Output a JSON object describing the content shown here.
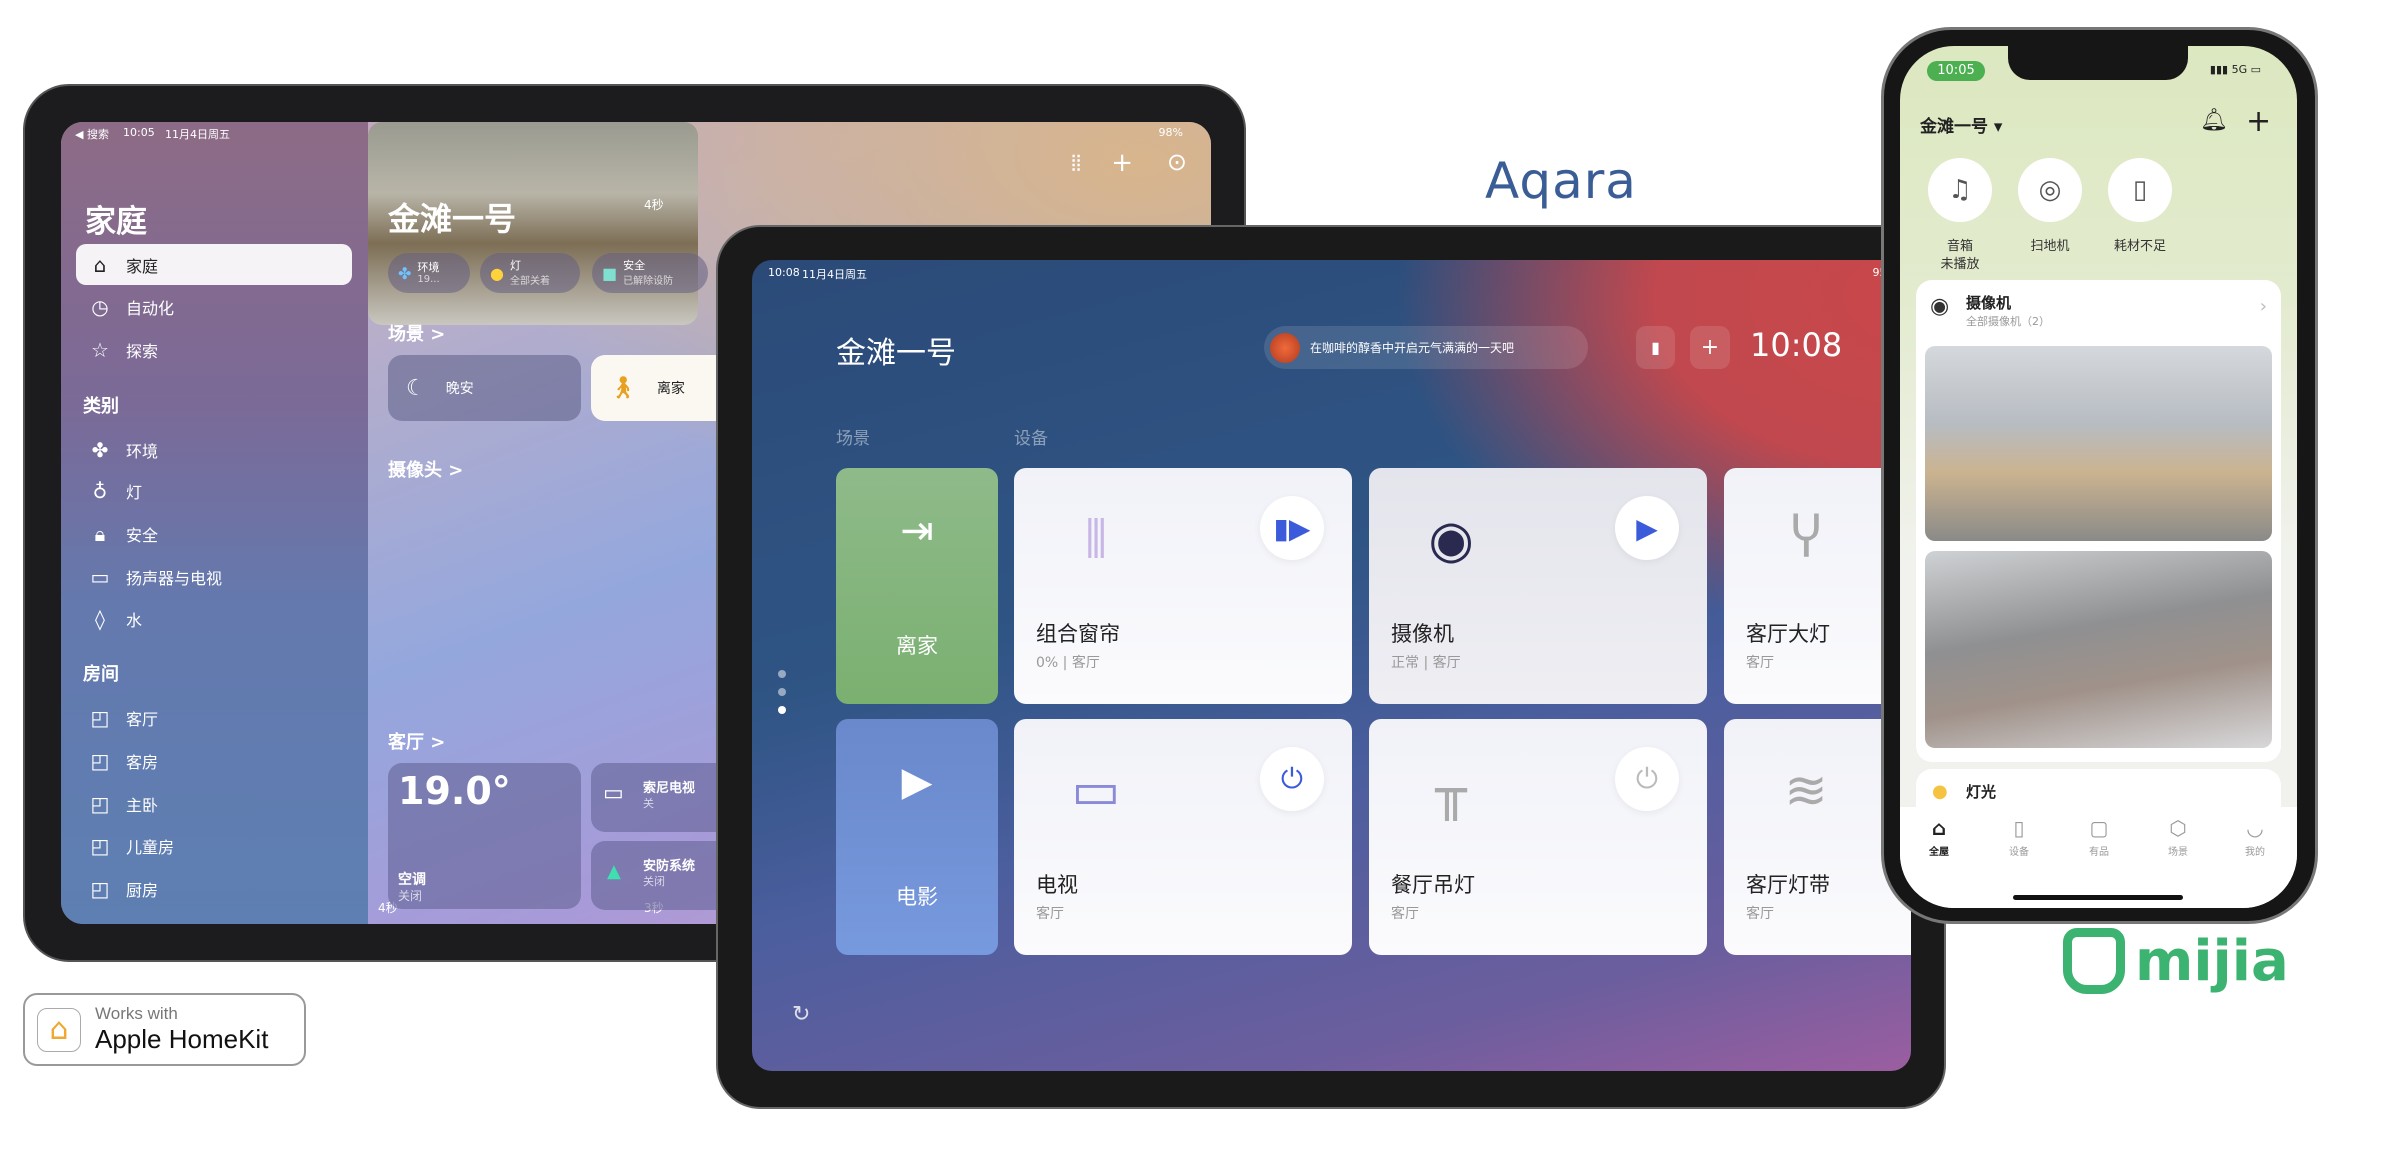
{
  "ipad_home": {
    "status": {
      "back": "◀ 搜索",
      "time": "10:05",
      "date": "11月4日周五",
      "battery": "98%"
    },
    "sidebar": {
      "title": "家庭",
      "items": [
        {
          "label": "家庭",
          "icon": "house-icon"
        },
        {
          "label": "自动化",
          "icon": "clock-icon"
        },
        {
          "label": "探索",
          "icon": "star-icon"
        }
      ],
      "category_title": "类别",
      "categories": [
        {
          "label": "环境",
          "icon": "fan-icon"
        },
        {
          "label": "灯",
          "icon": "bulb-icon"
        },
        {
          "label": "安全",
          "icon": "lock-icon"
        },
        {
          "label": "扬声器与电视",
          "icon": "tv-speaker-icon"
        },
        {
          "label": "水",
          "icon": "drop-icon"
        }
      ],
      "room_title": "房间",
      "rooms": [
        "客厅",
        "客房",
        "主卧",
        "儿童房",
        "厨房"
      ]
    },
    "main": {
      "title": "金滩一号",
      "chips": [
        {
          "title": "环境",
          "sub": "19..."
        },
        {
          "title": "灯",
          "sub": "全部关着"
        },
        {
          "title": "安全",
          "sub": "已解除设防"
        }
      ],
      "scenes_label": "场景 >",
      "scenes": [
        {
          "label": "晚安"
        },
        {
          "label": "离家"
        }
      ],
      "cameras_label": "摄像头 >",
      "camera_tags": [
        "4秒",
        "4秒",
        "3秒"
      ],
      "room_label": "客厅 >",
      "climate": {
        "temp": "19.0°",
        "name": "空调",
        "state": "关闭"
      },
      "accessories": [
        {
          "name": "索尼电视",
          "state": "关"
        },
        {
          "name": "安防系统",
          "state": "关闭"
        }
      ]
    }
  },
  "aqara_tablet": {
    "status": {
      "time": "10:08",
      "date": "11月4日周五",
      "battery": "95%"
    },
    "home_title": "金滩一号",
    "message": "在咖啡的醇香中开启元气满满的一天吧",
    "clock": "10:08",
    "scenes_label": "场景",
    "devices_label": "设备",
    "scenes": [
      {
        "label": "离家",
        "color": "#7fae74"
      },
      {
        "label": "电影",
        "color": "#6f8fd6"
      }
    ],
    "devices": [
      {
        "name": "组合窗帘",
        "status": "0% | 客厅",
        "control": "play-pause-icon"
      },
      {
        "name": "摄像机",
        "status": "正常 | 客厅",
        "control": "play-icon"
      },
      {
        "name": "客厅大灯",
        "status": "客厅"
      },
      {
        "name": "电视",
        "status": "客厅",
        "control": "power-icon"
      },
      {
        "name": "餐厅吊灯",
        "status": "客厅",
        "control": "power-icon"
      },
      {
        "name": "客厅灯带",
        "status": "客厅"
      }
    ]
  },
  "mijia_phone": {
    "status": {
      "time": "10:05",
      "network": "5G"
    },
    "home_title": "金滩一号",
    "quick": [
      {
        "label": "音箱\n未播放",
        "l1": "音箱",
        "l2": "未播放"
      },
      {
        "l1": "扫地机"
      },
      {
        "l1": "耗材不足"
      }
    ],
    "camera_card": {
      "title": "摄像机",
      "sub": "全部摄像机（2）"
    },
    "light_card": {
      "title": "灯光"
    },
    "tabs": [
      "全屋",
      "设备",
      "有品",
      "场景",
      "我的"
    ],
    "accent": "#4caf50"
  },
  "logos": {
    "aqara": "Aqara",
    "mijia": "mijia",
    "homekit_top": "Works with",
    "homekit_bottom": "Apple HomeKit"
  }
}
